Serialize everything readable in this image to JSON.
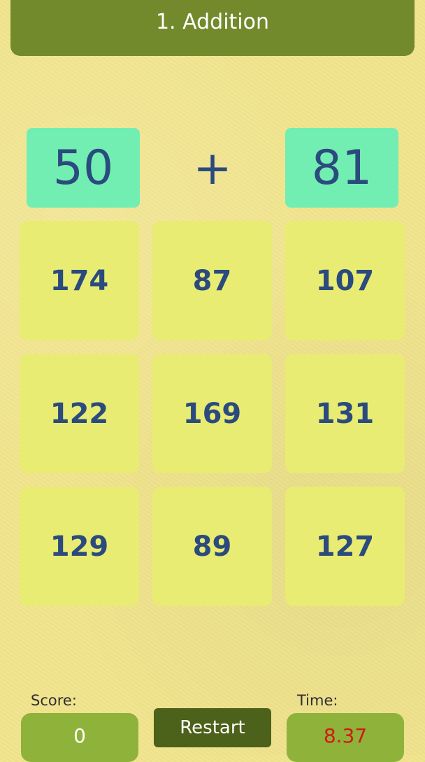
{
  "header": {
    "title": "1. Addition"
  },
  "problem": {
    "left": "50",
    "operator": "+",
    "right": "81"
  },
  "answers": [
    "174",
    "87",
    "107",
    "122",
    "169",
    "131",
    "129",
    "89",
    "127"
  ],
  "footer": {
    "score_label": "Score:",
    "score_value": "0",
    "restart_label": "Restart",
    "time_label": "Time:",
    "time_value": "8.37"
  },
  "colors": {
    "background": "#f1e48e",
    "header": "#728a2c",
    "operand_tile": "#72eeb2",
    "answer_tile": "#e8ec72",
    "number_text": "#2b4a7e",
    "footer_box": "#8fb33a",
    "restart_button": "#4c6119",
    "time_text": "#d11a12"
  }
}
